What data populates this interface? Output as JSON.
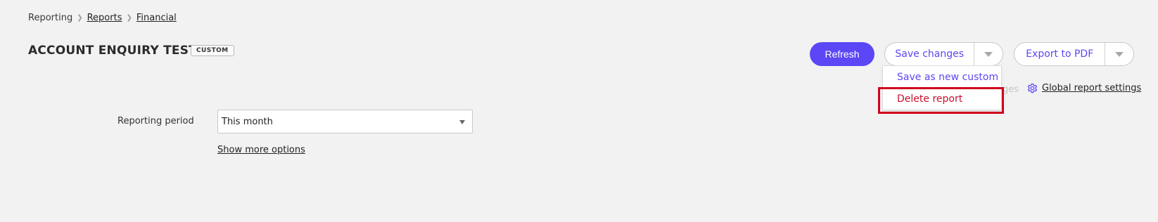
{
  "breadcrumb": {
    "root": "Reporting",
    "items": [
      "Reports",
      "Financial"
    ]
  },
  "header": {
    "title": "ACCOUNT ENQUIRY TEST",
    "badge": "CUSTOM"
  },
  "actions": {
    "refresh_label": "Refresh",
    "save_label": "Save changes",
    "export_label": "Export to PDF"
  },
  "save_menu": {
    "items": [
      "Save as new custom",
      "Delete report"
    ]
  },
  "settings": {
    "faded_text": "ges",
    "global_label": "Global report settings"
  },
  "form": {
    "reporting_period_label": "Reporting period",
    "reporting_period_value": "This month",
    "more_options_label": "Show more options"
  },
  "colors": {
    "accent": "#5b47f5",
    "danger": "#c8102e",
    "highlight": "#d0021b",
    "background": "#f2f2f2"
  },
  "icons": {
    "breadcrumb_separator": "chevron-right-icon",
    "dropdown": "caret-down-icon",
    "settings": "gear-icon"
  }
}
